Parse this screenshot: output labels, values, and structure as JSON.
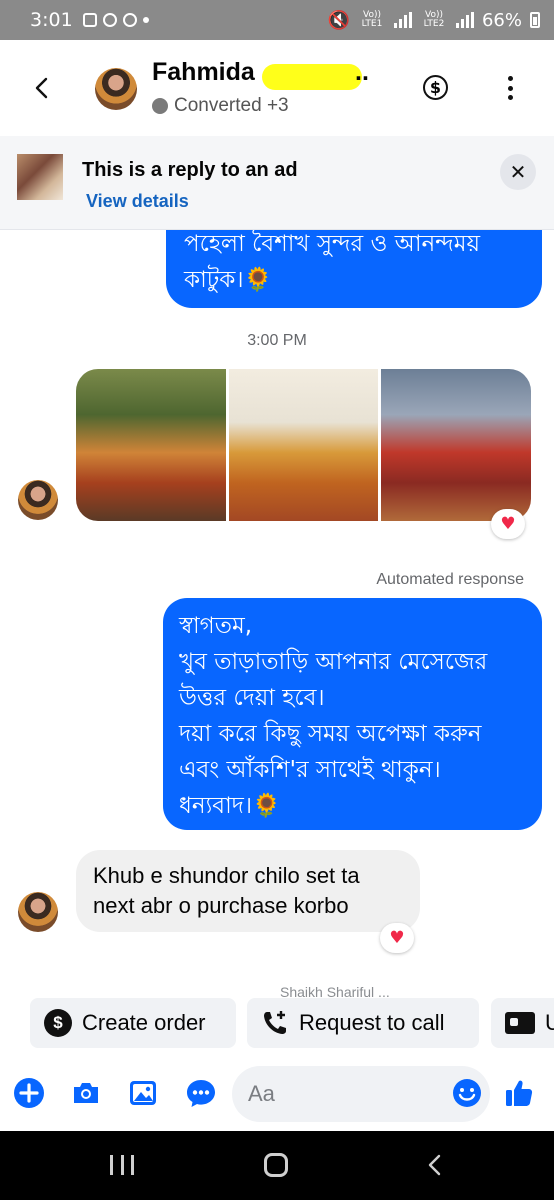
{
  "status_bar": {
    "time": "3:01",
    "right_label": "VoLTE1 VoLTE2",
    "lte1": "Vo)) LTE1",
    "lte2": "Vo)) LTE2",
    "battery": "66%"
  },
  "header": {
    "contact_name": "Fahmida",
    "name_suffix": "..",
    "status_label": "Converted +3"
  },
  "ad_banner": {
    "title": "This is a reply to an ad",
    "link": "View details",
    "close_glyph": "✕"
  },
  "messages": {
    "top_bubble_lines": [
      "পহেলা বৈশাখ সুন্দর ও আনন্দময়",
      "কাটুক।🌻"
    ],
    "timestamp": "3:00 PM",
    "heart": "♥",
    "automated_label": "Automated response",
    "auto_reply_lines": [
      "স্বাগতম,",
      "খুব তাড়াতাড়ি আপনার মেসেজের",
      "উত্তর দেয়া হবে।",
      "দয়া করে কিছু সময় অপেক্ষা করুন",
      "এবং আঁকশি'র সাথেই থাকুন।",
      "ধন্যবাদ।🌻"
    ],
    "incoming_lines": [
      "Khub e shundor chilo set ta",
      "next abr o purchase korbo"
    ],
    "peek_text": "Shaikh Shariful ... "
  },
  "chips": {
    "create_order": "Create order",
    "request_call": "Request to call",
    "third": "U"
  },
  "composer": {
    "placeholder": "Aa"
  },
  "colors": {
    "accent": "#0866ff",
    "link": "#1564c0",
    "status_bar": "#8a8a8a",
    "redaction": "#ffff1a"
  }
}
